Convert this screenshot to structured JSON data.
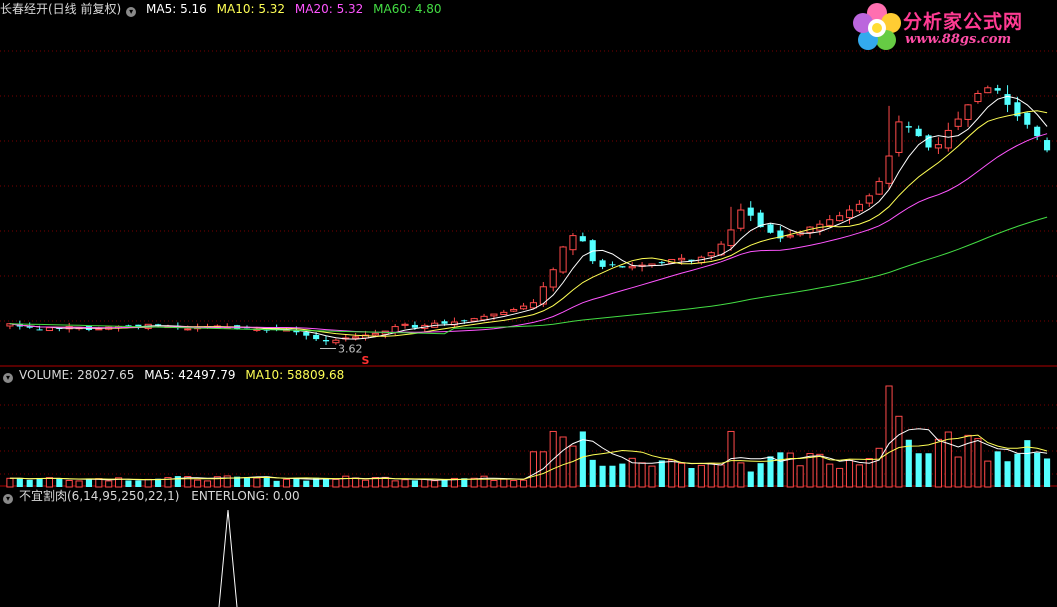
{
  "main_panel": {
    "title": "长春经开(日线 前复权)",
    "ma5_label": "MA5: 5.16",
    "ma10_label": "MA10: 5.32",
    "ma20_label": "MA20: 5.32",
    "ma60_label": "MA60: 4.80",
    "low_marker": "3.62",
    "signal_marker": "S"
  },
  "volume_panel": {
    "volume_label": "VOLUME: 28027.65",
    "ma5_label": "MA5: 42497.79",
    "ma10_label": "MA10: 58809.68"
  },
  "indicator_panel": {
    "label": "不宜割肉(6,14,95,250,22,1)",
    "value_label": "ENTERLONG: 0.00"
  },
  "watermark": {
    "name": "分析家公式网",
    "url": "www.88gs.com"
  },
  "colors": {
    "background": "#000000",
    "up_candle": "#ff4a4a",
    "down_candle": "#54ffff",
    "ma5": "#ffffff",
    "ma10": "#ffff55",
    "ma20": "#ff55ff",
    "ma60": "#44dd44",
    "grid": "#7a0000",
    "divider": "#b00000"
  },
  "chart_data": [
    {
      "type": "candlestick",
      "name": "price",
      "title": "长春经开(日线 前复权)",
      "ma_values": {
        "MA5": 5.16,
        "MA10": 5.32,
        "MA20": 5.32,
        "MA60": 4.8
      },
      "annotated_low": 3.62,
      "close_estimates": [
        3.95,
        3.9,
        3.88,
        3.85,
        3.88,
        3.86,
        3.9,
        3.88,
        3.84,
        3.86,
        3.89,
        3.9,
        3.92,
        3.9,
        3.94,
        3.92,
        3.9,
        3.88,
        3.86,
        3.88,
        3.9,
        3.91,
        3.89,
        3.86,
        3.87,
        3.85,
        3.83,
        3.86,
        3.84,
        3.8,
        3.74,
        3.68,
        3.64,
        3.66,
        3.7,
        3.72,
        3.75,
        3.78,
        3.82,
        3.9,
        3.94,
        3.88,
        3.92,
        3.96,
        3.95,
        3.98,
        4.0,
        4.04,
        4.08,
        4.12,
        4.15,
        4.2,
        4.26,
        4.32,
        4.6,
        4.9,
        5.3,
        5.5,
        5.4,
        5.05,
        4.95,
        4.98,
        4.94,
        4.96,
        4.98,
        5.0,
        5.02,
        5.08,
        5.1,
        5.05,
        5.12,
        5.2,
        5.35,
        5.6,
        5.95,
        5.85,
        5.65,
        5.55,
        5.45,
        5.5,
        5.55,
        5.65,
        5.7,
        5.78,
        5.85,
        5.95,
        6.05,
        6.2,
        6.45,
        6.9,
        7.5,
        7.4,
        7.25,
        7.05,
        7.1,
        7.35,
        7.55,
        7.8,
        8.0,
        8.1,
        8.05,
        7.8,
        7.6,
        7.45,
        7.25,
        7.0
      ]
    },
    {
      "type": "bar",
      "name": "volume",
      "values_label": {
        "VOLUME": 28027.65,
        "MA5": 42497.79,
        "MA10": 58809.68
      }
    },
    {
      "type": "line",
      "name": "ENTERLONG",
      "indicator": "不宜割肉(6,14,95,250,22,1)",
      "current_value": 0.0,
      "spike": {
        "x_index": 21,
        "value": 1
      }
    }
  ]
}
